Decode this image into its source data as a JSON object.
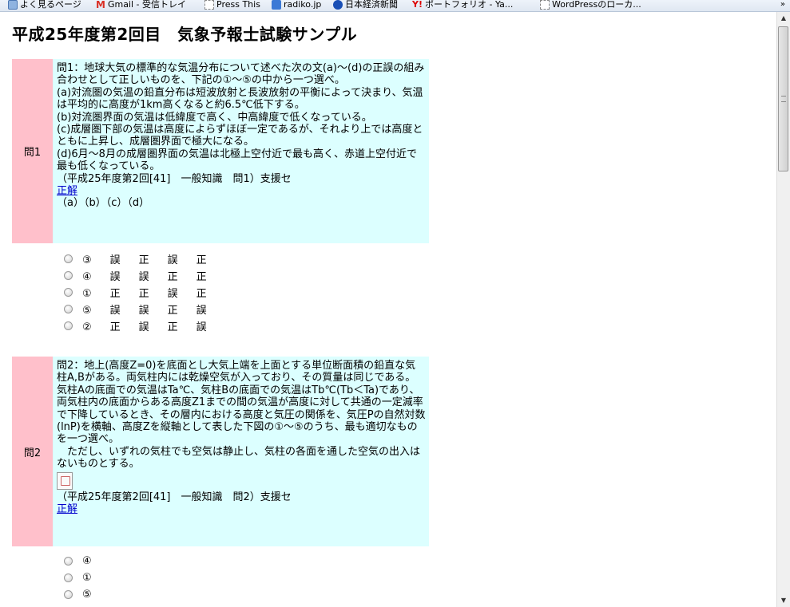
{
  "bookmarks": [
    {
      "label": "よく見るページ",
      "icon": "star-icon"
    },
    {
      "label": "Gmail - 受信トレイ",
      "icon": "gmail-icon"
    },
    {
      "label": "Press This",
      "icon": "page-icon"
    },
    {
      "label": "radiko.jp",
      "icon": "radiko-icon"
    },
    {
      "label": "日本経済新聞",
      "icon": "nikkei-icon"
    },
    {
      "label": "ポートフォリオ - Ya...",
      "icon": "yahoo-icon"
    },
    {
      "label": "WordPressのローカ...",
      "icon": "page-icon"
    }
  ],
  "page": {
    "title": "平成25年度第2回目　気象予報士試験サンプル"
  },
  "questions": [
    {
      "label": "問1",
      "lines": [
        "問1：地球大気の標準的な気温分布について述べた次の文(a)〜(d)の正誤の組み合わせとして正しいものを、下記の①〜⑤の中から一つ選べ。",
        "(a)対流圏の気温の鉛直分布は短波放射と長波放射の平衡によって決まり、気温は平均的に高度が1km高くなると約6.5℃低下する。",
        "(b)対流圏界面の気温は低緯度で高く、中高緯度で低くなっている。",
        "(c)成層圏下部の気温は高度によらずほぼ一定であるが、それより上では高度とともに上昇し、成層圏界面で極大になる。",
        "(d)6月〜8月の成層圏界面の気温は北極上空付近で最も高く、赤道上空付近で最も低くなっている。",
        "（平成25年度第2回[41]　一般知識　問1）支援セ"
      ],
      "answer_link": "正解",
      "header_row": "（a）（b）（c）（d）",
      "choices": [
        "③　誤　正　誤　正",
        "④　誤　誤　正　正",
        "①　正　正　誤　正",
        "⑤　誤　誤　正　誤",
        "②　正　誤　正　誤"
      ]
    },
    {
      "label": "問2",
      "lines": [
        "問2：地上(高度Z=0)を底面とし大気上端を上面とする単位断面積の鉛直な気柱A,Bがある。両気柱内には乾燥空気が入っており、その質量は同じである。気柱Aの底面での気温はTa℃、気柱Bの底面での気温はTb℃(Tb＜Ta)であり、両気柱内の底面からある高度Z1までの間の気温が高度に対して共通の一定減率で下降しているとき、その層内における高度と気圧の関係を、気圧Pの自然対数(lnP)を横軸、高度Zを縦軸として表した下図の①〜⑤のうち、最も適切なものを一つ選べ。",
        "　ただし、いずれの気柱でも空気は静止し、気柱の各面を通した空気の出入はないものとする。"
      ],
      "source": "（平成25年度第2回[41]　一般知識　問2）支援セ",
      "answer_link": "正解",
      "choices": [
        "④",
        "①",
        "⑤"
      ]
    }
  ],
  "colors": {
    "label_bg": "#ffc0cb",
    "body_bg": "#dcffff",
    "link": "#0000cc"
  }
}
